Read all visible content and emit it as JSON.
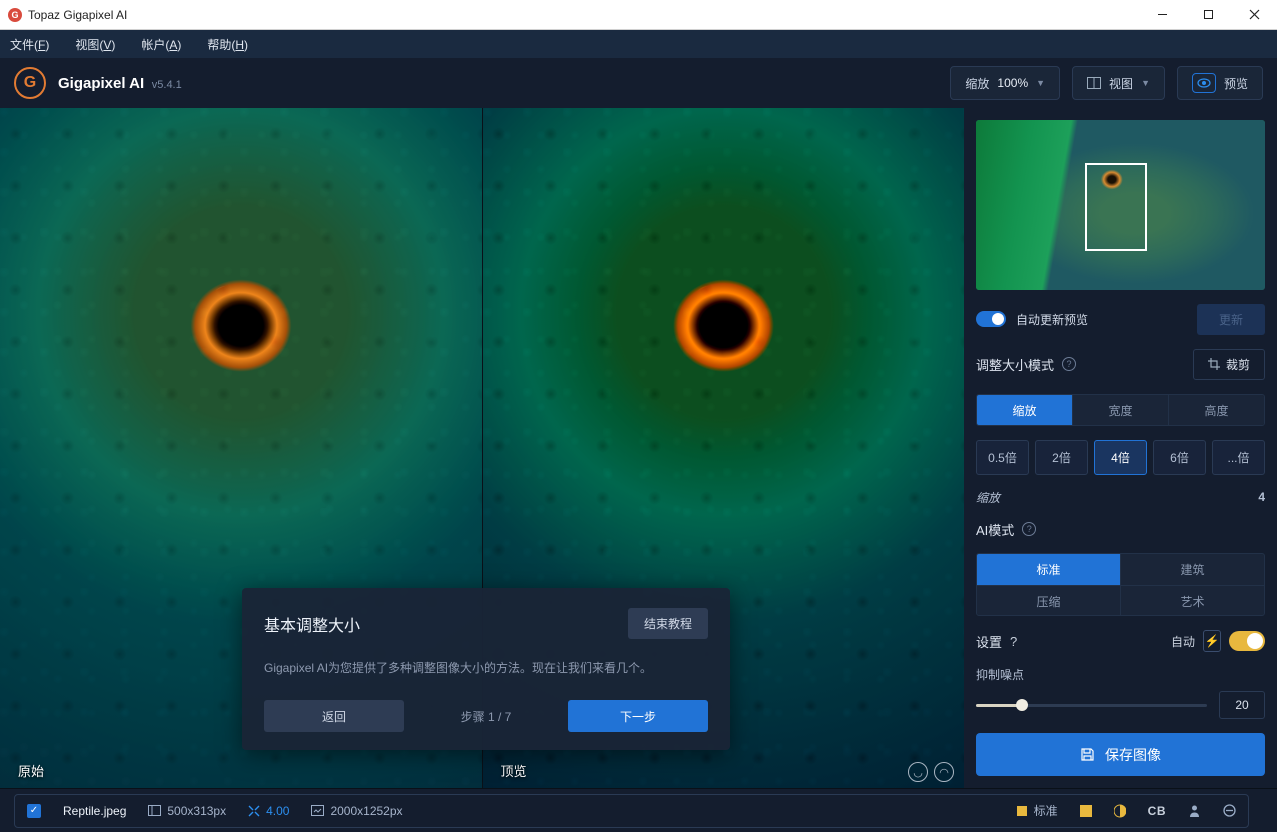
{
  "window_title": "Topaz Gigapixel AI",
  "menu": {
    "file": "文件(F)",
    "view": "视图(V)",
    "account": "帐户(A)",
    "help": "帮助(H)"
  },
  "app": {
    "logo_letter": "G",
    "name": "Gigapixel AI",
    "version": "v5.4.1"
  },
  "appbar": {
    "zoom_label": "缩放",
    "zoom_value": "100%",
    "view_label": "视图",
    "preview_label": "预览"
  },
  "viewport": {
    "left_label": "原始",
    "right_label": "顶览"
  },
  "tutorial": {
    "title": "基本调整大小",
    "end": "结束教程",
    "body": "Gigapixel AI为您提供了多种调整图像大小的方法。现在让我们来看几个。",
    "back": "返回",
    "step": "步骤 1 / 7",
    "next": "下一步"
  },
  "sidebar": {
    "auto_update_label": "自动更新预览",
    "update_btn": "更新",
    "resize_mode_label": "调整大小模式",
    "crop_label": "裁剪",
    "mode_tabs": [
      "缩放",
      "宽度",
      "高度"
    ],
    "scale_options": [
      "0.5倍",
      "2倍",
      "4倍",
      "6倍",
      "...倍"
    ],
    "scale_active_index": 2,
    "scale_kv_label": "缩放",
    "scale_kv_value": "4",
    "ai_mode_label": "AI模式",
    "ai_tabs": [
      "标准",
      "建筑",
      "压缩",
      "艺术"
    ],
    "ai_active_index": 0,
    "settings_label": "设置",
    "auto_label": "自动",
    "noise_label": "抑制噪点",
    "noise_value": "20",
    "save_label": "保存图像"
  },
  "footer": {
    "filename": "Reptile.jpeg",
    "src_dim": "500x313px",
    "scale": "4.00",
    "out_dim": "2000x1252px",
    "mode": "标准",
    "cb": "CB"
  }
}
